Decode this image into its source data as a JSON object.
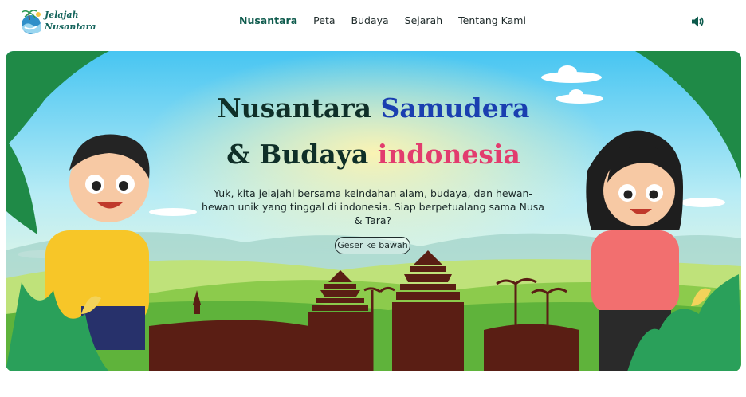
{
  "brand": {
    "line1": "Jelajah",
    "line2": "Nusantara",
    "logo_icon": "wave-island-logo-icon"
  },
  "nav": [
    {
      "label": "Nusantara",
      "active": true
    },
    {
      "label": "Peta",
      "active": false
    },
    {
      "label": "Budaya",
      "active": false
    },
    {
      "label": "Sejarah",
      "active": false
    },
    {
      "label": "Tentang Kami",
      "active": false
    }
  ],
  "audio": {
    "icon": "speaker-icon"
  },
  "hero": {
    "title_line1_a": "Nusantara",
    "title_line1_b": "Samudera",
    "title_line2_a": "& Budaya",
    "title_line2_b": "indonesia",
    "description": "Yuk, kita jelajahi bersama keindahan alam, budaya, dan hewan-hewan unik yang tinggal di indonesia. Siap berpetualang sama Nusa & Tara?",
    "scroll_button": "Geser ke bawah"
  },
  "colors": {
    "brand": "#14645c",
    "title_dark": "#0f2f28",
    "title_blue": "#1a3fb0",
    "title_pink": "#e23c6e",
    "silhouette": "#5a1e14"
  }
}
